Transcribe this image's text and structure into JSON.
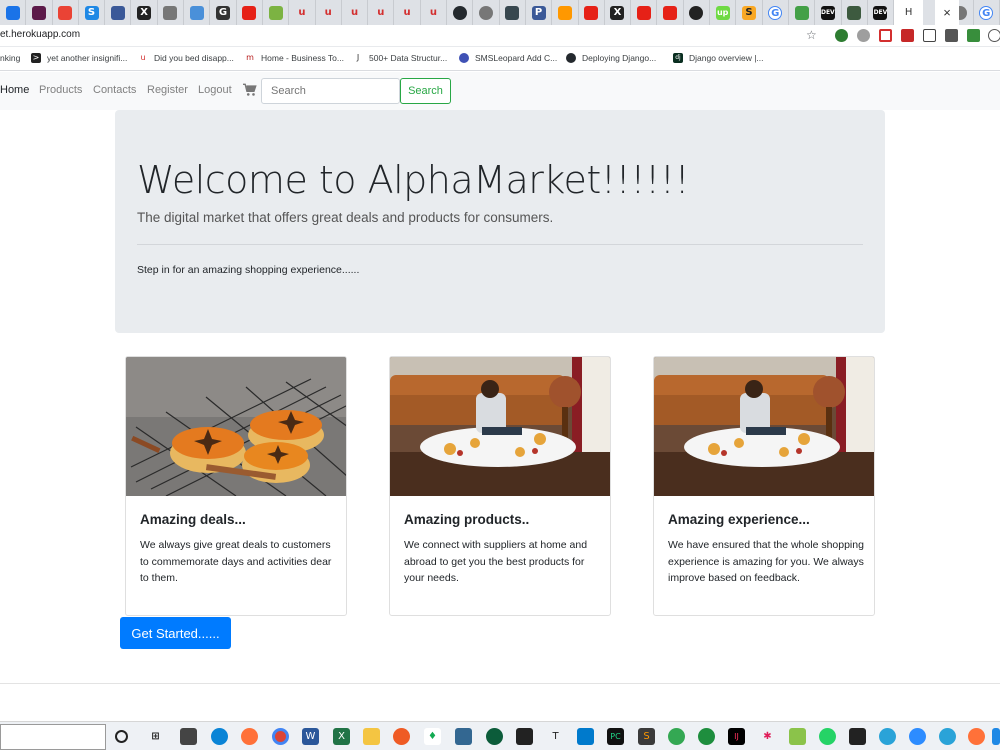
{
  "browser": {
    "tabs": [
      "",
      "",
      "",
      "S",
      "",
      "X",
      "",
      "",
      "G",
      "",
      "",
      "u",
      "u",
      "u",
      "u",
      "u",
      "u",
      "",
      "",
      "",
      "P",
      "",
      "",
      "X",
      "",
      "",
      "",
      "up",
      "S",
      "G",
      "",
      "DEV",
      "",
      "DEV",
      "",
      "",
      "G"
    ],
    "active_tab_label": "H",
    "close_glyph": "×",
    "url": "et.herokuapp.com"
  },
  "bookmarks": [
    {
      "label": "nking",
      "icon": ""
    },
    {
      "label": "yet another insignifi...",
      "icon": ">"
    },
    {
      "label": "Did you bed disapp...",
      "icon": "u"
    },
    {
      "label": "Home - Business To...",
      "icon": "m"
    },
    {
      "label": "500+ Data Structur...",
      "icon": "J"
    },
    {
      "label": "SMSLeopard Add C...",
      "icon": ""
    },
    {
      "label": "Deploying Django...",
      "icon": ""
    },
    {
      "label": "Django overview |...",
      "icon": "dj"
    }
  ],
  "navbar": {
    "links": [
      "Home",
      "Products",
      "Contacts",
      "Register",
      "Logout"
    ],
    "search_placeholder": "Search",
    "search_button": "Search"
  },
  "jumbotron": {
    "title": "Welcome to AlphaMarket!!!!!!",
    "lead": "The digital market that offers great deals and products for consumers.",
    "text": "Step in for an amazing shopping experience......"
  },
  "cards": [
    {
      "title": "Amazing deals...",
      "text": "We always give great deals to customers to commemorate days and activities dear to them."
    },
    {
      "title": "Amazing products..",
      "text": "We connect with suppliers at home and abroad to get you the best products for your needs."
    },
    {
      "title": "Amazing experience...",
      "text": "We have ensured that the whole shopping experience is amazing for you. We always improve based on feedback."
    }
  ],
  "cta": {
    "label": "Get Started......"
  },
  "colors": {
    "primary": "#007bff",
    "success": "#28a745",
    "jumbotron_bg": "#e9ecef",
    "navbar_bg": "#f8f9fa"
  },
  "taskbar": {
    "icons": [
      "search-icon",
      "task-view-icon",
      "store-icon",
      "edge-icon",
      "firefox-icon",
      "chrome-icon",
      "word-icon",
      "excel-icon",
      "explorer-icon",
      "postman-icon",
      "mongodb-icon",
      "postgres-icon",
      "gitkraken-icon",
      "terminal-icon",
      "typora-icon",
      "vscode-icon",
      "pycharm-icon",
      "sublime-icon",
      "chrome2-icon",
      "chrome3-icon",
      "intellij-icon",
      "slack-icon",
      "notepad-icon",
      "whatsapp-icon",
      "anki-icon",
      "telegram-icon",
      "zoom-icon",
      "telegram2-icon",
      "firefox2-icon",
      "app-icon"
    ]
  }
}
